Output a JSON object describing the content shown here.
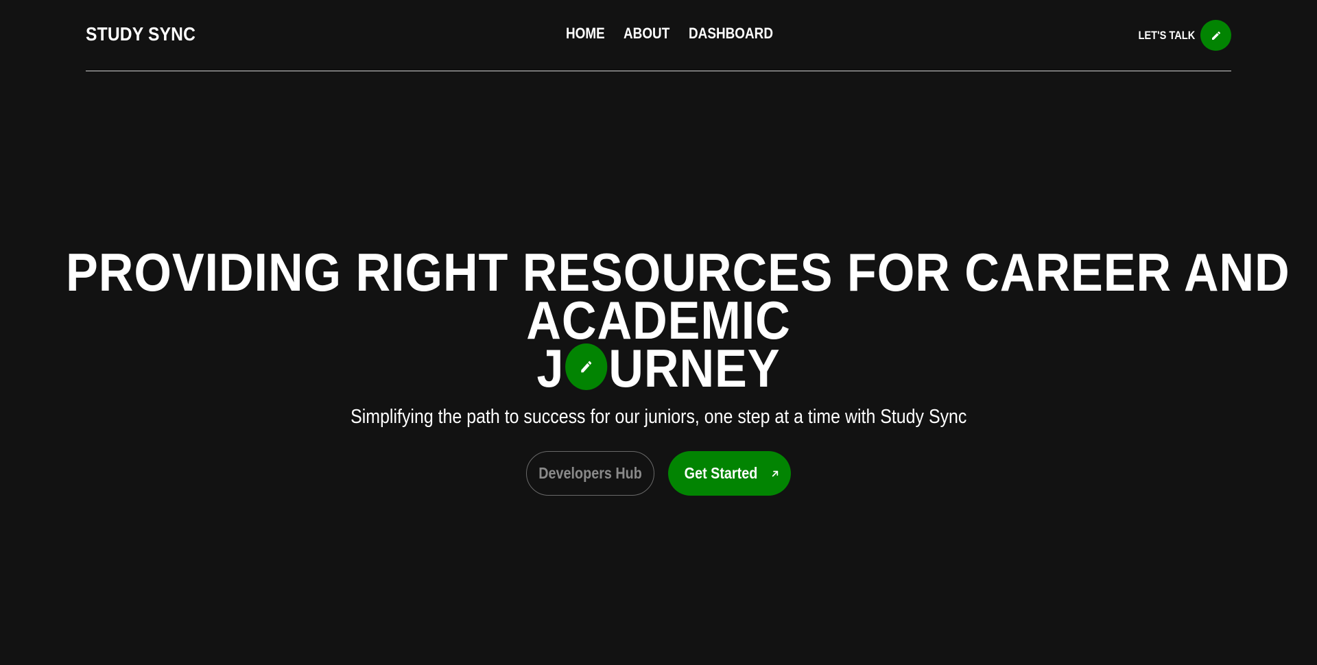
{
  "header": {
    "brand": "STUDY SYNC",
    "nav": [
      {
        "label": "HOME"
      },
      {
        "label": "ABOUT"
      },
      {
        "label": "DASHBOARD"
      }
    ],
    "cta_label": "LET'S TALK",
    "cta_icon": "pencil-icon"
  },
  "hero": {
    "title_line1": "PROVIDING RIGHT RESOURCES FOR CAREER AND",
    "title_line2": "ACADEMIC",
    "title_line3_before": "J",
    "title_line3_after": "URNEY",
    "title_badge_icon": "pencil-icon",
    "subtitle": "Simplifying the path to success for our juniors, one step at a time with Study Sync",
    "secondary_button": "Developers Hub",
    "primary_button": "Get Started",
    "primary_button_icon": "arrow-up-right-icon"
  },
  "colors": {
    "background": "#121212",
    "accent": "#028402",
    "text": "#ffffff",
    "muted": "#8a8a8a"
  }
}
